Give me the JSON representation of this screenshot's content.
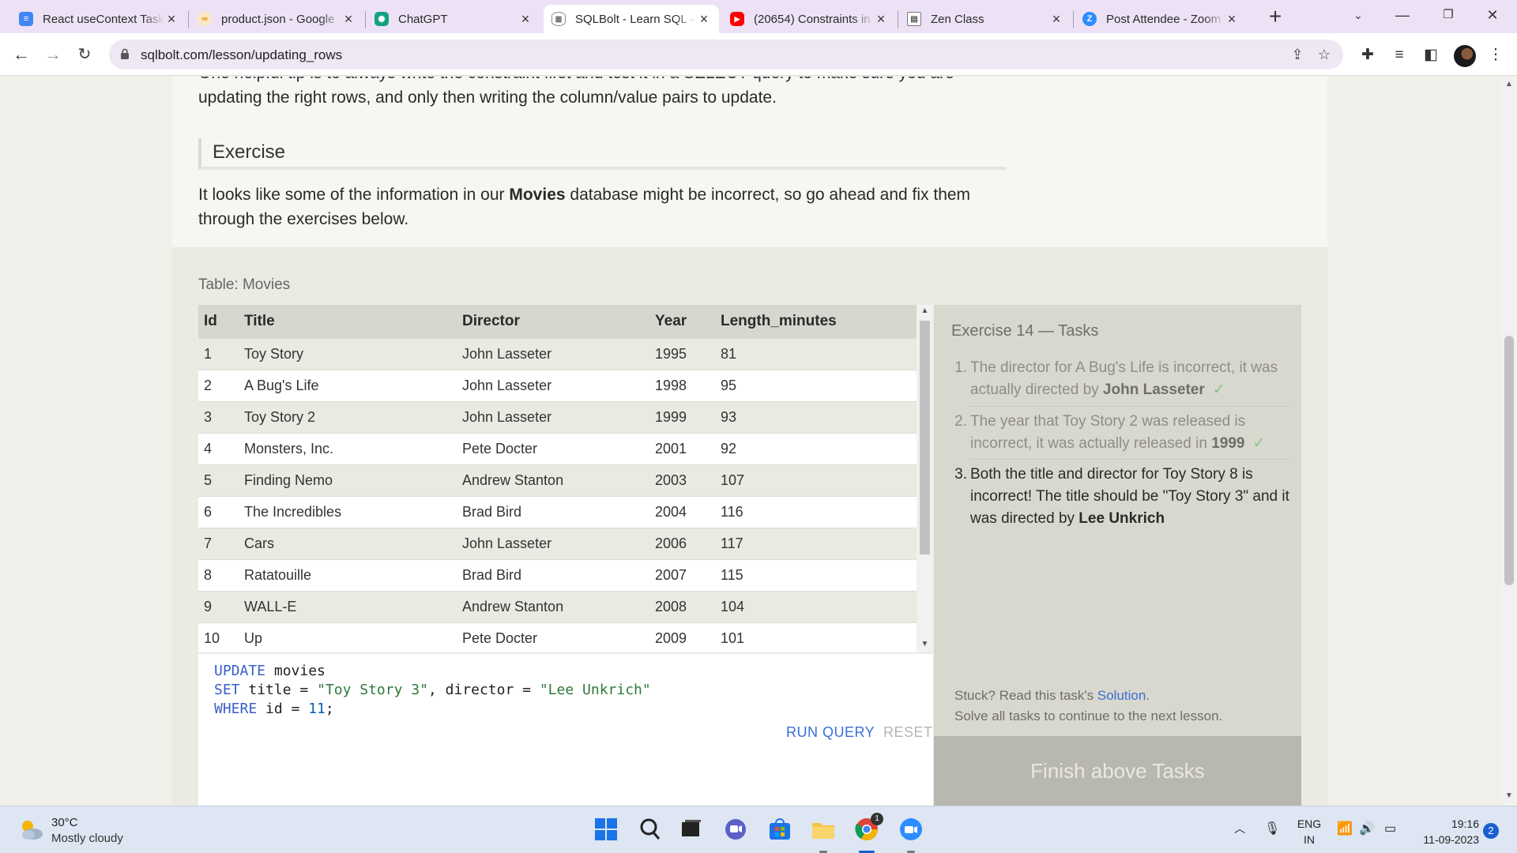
{
  "browser": {
    "tabs": [
      {
        "title": "React useContext Task",
        "favicon": "docs-icon",
        "color": "#4285f4"
      },
      {
        "title": "product.json - Google",
        "favicon": "colab-icon",
        "color": "#e8a33c"
      },
      {
        "title": "ChatGPT",
        "favicon": "chatgpt-icon",
        "color": "#10a37f"
      },
      {
        "title": "SQLBolt - Learn SQL -",
        "favicon": "database-icon",
        "color": "#555555"
      },
      {
        "title": "(20654) Constraints in",
        "favicon": "youtube-icon",
        "color": "#ff0000"
      },
      {
        "title": "Zen Class",
        "favicon": "zen-icon",
        "color": "#666666"
      },
      {
        "title": "Post Attendee - Zoom",
        "favicon": "zoom-icon",
        "color": "#2d8cff"
      }
    ],
    "url": "sqlbolt.com/lesson/updating_rows"
  },
  "lesson": {
    "intro_line1": "One helpful tip is to always write the constraint first and test it in a SELECT query to make sure you are",
    "intro_line2": "updating the right rows, and only then writing the column/value pairs to update.",
    "exercise_heading": "Exercise",
    "exercise_desc_pre": "It looks like some of the information in our ",
    "exercise_desc_bold": "Movies",
    "exercise_desc_post": " database might be incorrect, so go ahead and fix them through the exercises below."
  },
  "table": {
    "caption": "Table: Movies",
    "headers": [
      "Id",
      "Title",
      "Director",
      "Year",
      "Length_minutes"
    ],
    "rows": [
      [
        "1",
        "Toy Story",
        "John Lasseter",
        "1995",
        "81"
      ],
      [
        "2",
        "A Bug's Life",
        "John Lasseter",
        "1998",
        "95"
      ],
      [
        "3",
        "Toy Story 2",
        "John Lasseter",
        "1999",
        "93"
      ],
      [
        "4",
        "Monsters, Inc.",
        "Pete Docter",
        "2001",
        "92"
      ],
      [
        "5",
        "Finding Nemo",
        "Andrew Stanton",
        "2003",
        "107"
      ],
      [
        "6",
        "The Incredibles",
        "Brad Bird",
        "2004",
        "116"
      ],
      [
        "7",
        "Cars",
        "John Lasseter",
        "2006",
        "117"
      ],
      [
        "8",
        "Ratatouille",
        "Brad Bird",
        "2007",
        "115"
      ],
      [
        "9",
        "WALL-E",
        "Andrew Stanton",
        "2008",
        "104"
      ],
      [
        "10",
        "Up",
        "Pete Docter",
        "2009",
        "101"
      ]
    ]
  },
  "editor": {
    "line1_kw": "UPDATE",
    "line1_rest": " movies",
    "line2_kw": "SET",
    "line2_a": " title = ",
    "line2_s1": "\"Toy Story 3\"",
    "line2_b": ", director = ",
    "line2_s2": "\"Lee Unkrich\"",
    "line3_kw": "WHERE",
    "line3_a": " id = ",
    "line3_num": "11",
    "line3_end": ";",
    "run_label": "RUN QUERY",
    "reset_label": "RESET"
  },
  "tasks": {
    "title": "Exercise 14 — Tasks",
    "items": [
      {
        "num": "1.",
        "text": "The director for A Bug's Life is incorrect, it was actually directed by ",
        "bold": "John Lasseter",
        "check": "✓",
        "done": true
      },
      {
        "num": "2.",
        "text": "The year that Toy Story 2 was released is incorrect, it was actually released in ",
        "bold": "1999",
        "check": "✓",
        "done": true
      },
      {
        "num": "3.",
        "text": "Both the title and director for Toy Story 8 is incorrect! The title should be \"Toy Story 3\" and it was directed by ",
        "bold": "Lee Unkrich",
        "check": "",
        "done": false
      }
    ],
    "stuck_pre": "Stuck? Read this task's ",
    "stuck_link": "Solution",
    "stuck_post": ".",
    "stuck_line2": "Solve all tasks to continue to the next lesson.",
    "finish_label": "Finish above Tasks"
  },
  "taskbar": {
    "weather_temp": "30°C",
    "weather_desc": "Mostly cloudy",
    "lang_line1": "ENG",
    "lang_line2": "IN",
    "time": "19:16",
    "date": "11-09-2023",
    "notifications": "2",
    "chrome_badge": "1"
  }
}
